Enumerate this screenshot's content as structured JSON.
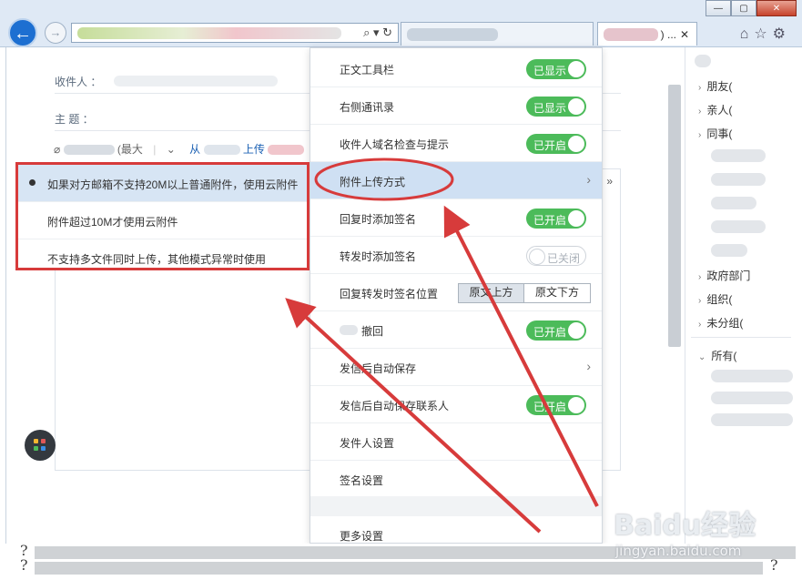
{
  "browser": {
    "tab2_text": ") ...",
    "tab2_close": "✕",
    "search_icons": "⌕ ▾ ↻"
  },
  "compose": {
    "recipient_label": "收件人 ：",
    "subject_label": "主    题 ：",
    "attach_hint": "(最大",
    "attach_link": "从",
    "attach_link_tail": "上传"
  },
  "settings_menu": {
    "items": [
      {
        "label": "正文工具栏",
        "control": "toggle",
        "state": "on",
        "state_text": "已显示"
      },
      {
        "label": "右侧通讯录",
        "control": "toggle",
        "state": "on",
        "state_text": "已显示"
      },
      {
        "label": "收件人域名检查与提示",
        "control": "toggle",
        "state": "on",
        "state_text": "已开启"
      },
      {
        "label": "附件上传方式",
        "control": "arrow",
        "active": true
      },
      {
        "label": "回复时添加签名",
        "control": "toggle",
        "state": "on",
        "state_text": "已开启"
      },
      {
        "label": "转发时添加签名",
        "control": "toggle",
        "state": "off",
        "state_text": "已关闭"
      },
      {
        "label": "回复转发时签名位置",
        "control": "segmented",
        "options": [
          "原文上方",
          "原文下方"
        ],
        "selected": 0
      },
      {
        "label": "撤回",
        "control": "toggle",
        "state": "on",
        "state_text": "已开启"
      },
      {
        "label": "发信后自动保存",
        "control": "arrow"
      },
      {
        "label": "发信后自动保存联系人",
        "control": "toggle",
        "state": "on",
        "state_text": "已开启"
      },
      {
        "label": "发件人设置",
        "control": "none"
      },
      {
        "label": "签名设置",
        "control": "none"
      },
      {
        "label": "更多设置",
        "control": "none"
      }
    ]
  },
  "upload_submenu": {
    "items": [
      {
        "label": "如果对方邮箱不支持20M以上普通附件，使用云附件",
        "selected": true
      },
      {
        "label": "附件超过10M才使用云附件",
        "selected": false
      },
      {
        "label": "不支持多文件同时上传，其他模式异常时使用",
        "selected": false
      }
    ]
  },
  "contacts": {
    "groups": [
      "朋友(",
      "亲人(",
      "同事(",
      "政府部门",
      "组织(",
      "未分组("
    ],
    "all_label": "所有("
  },
  "status": {
    "help_glyph": "?"
  },
  "watermark": {
    "logo": "Baidu经验",
    "url": "jingyan.baidu.com"
  },
  "colors": {
    "toggle_on": "#4cbb5a",
    "highlight": "#cfe0f3",
    "annotation_red": "#d73b3b",
    "link_blue": "#1d62b4"
  }
}
